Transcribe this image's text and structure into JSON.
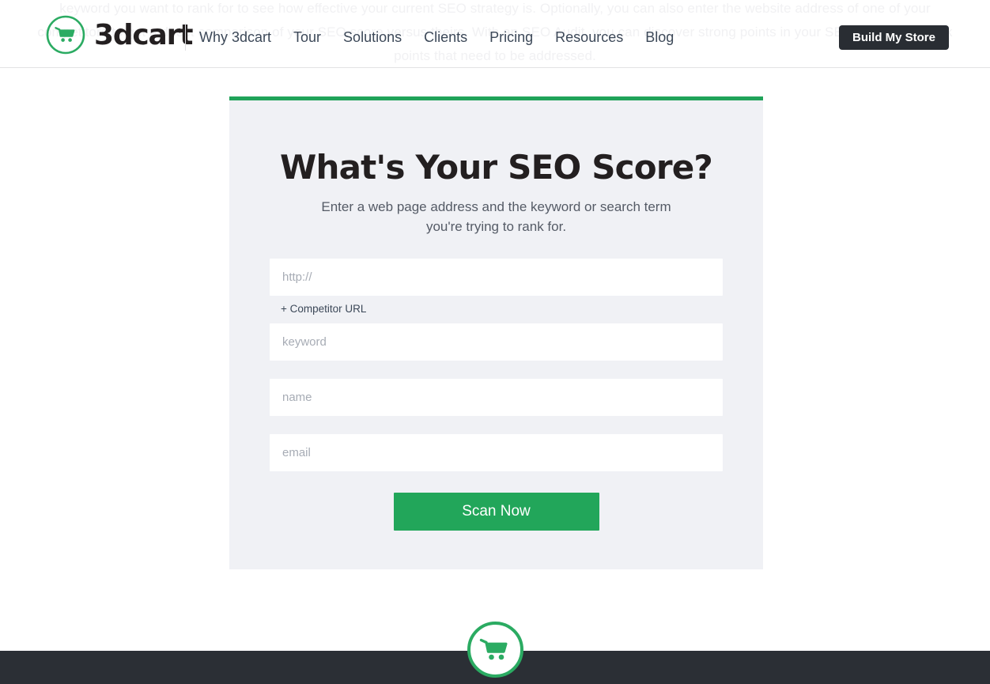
{
  "background": {
    "watermark_text": "keyword you want to rank for to see how effective your current SEO strategy is. Optionally, you can also enter the website address of one of your competitors to get a direct comparison of your SEO score versus theirs. With an SEO Audit, you can discover strong points in your SEO as well as weak points that need to be addressed."
  },
  "header": {
    "brand_name": "3dcart",
    "brand_icon": "shopping-cart-icon",
    "nav": [
      {
        "label": "Why 3dcart"
      },
      {
        "label": "Tour"
      },
      {
        "label": "Solutions"
      },
      {
        "label": "Clients"
      },
      {
        "label": "Pricing"
      },
      {
        "label": "Resources"
      },
      {
        "label": "Blog"
      }
    ],
    "cta_label": "Build My Store"
  },
  "card": {
    "title": "What's Your SEO Score?",
    "subtitle": "Enter a web page address and the keyword or search term you're trying to rank for.",
    "fields": {
      "url": {
        "value": "",
        "placeholder": "http://"
      },
      "keyword": {
        "value": "",
        "placeholder": "keyword"
      },
      "name": {
        "value": "",
        "placeholder": "name"
      },
      "email": {
        "value": "",
        "placeholder": "email"
      }
    },
    "competitor_link_label": "+ Competitor URL",
    "submit_label": "Scan Now"
  },
  "footer": {
    "badge_icon": "shopping-cart-icon"
  },
  "colors": {
    "accent_green": "#22a65a",
    "card_bg": "#f0f1f5",
    "dark": "#292d33",
    "footer_bar": "#2b2f35",
    "text": "#3c4858"
  }
}
